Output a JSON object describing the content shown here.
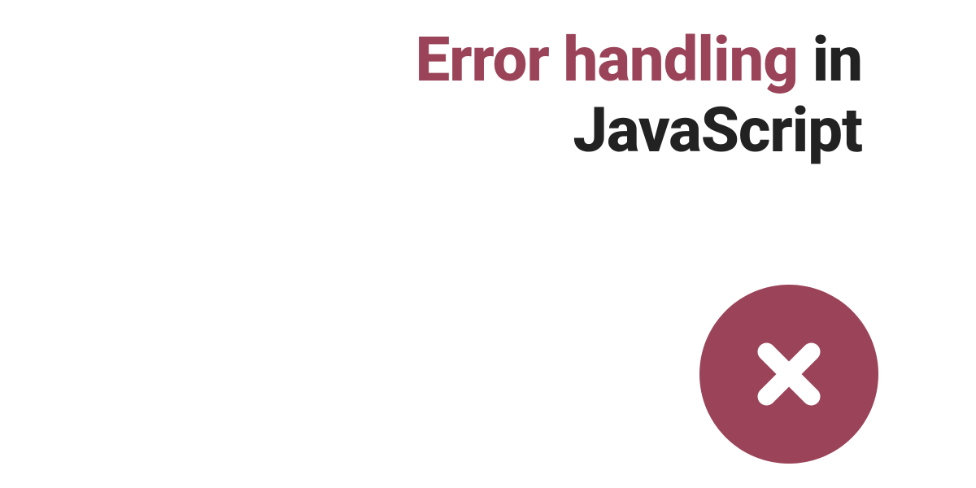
{
  "heading": {
    "line1_accent": "Error handling",
    "line1_dark": " in",
    "line2": "JavaScript"
  },
  "colors": {
    "accent": "#9b4459",
    "dark": "#222222",
    "background": "#ffffff"
  },
  "icon": "error-x-circle"
}
